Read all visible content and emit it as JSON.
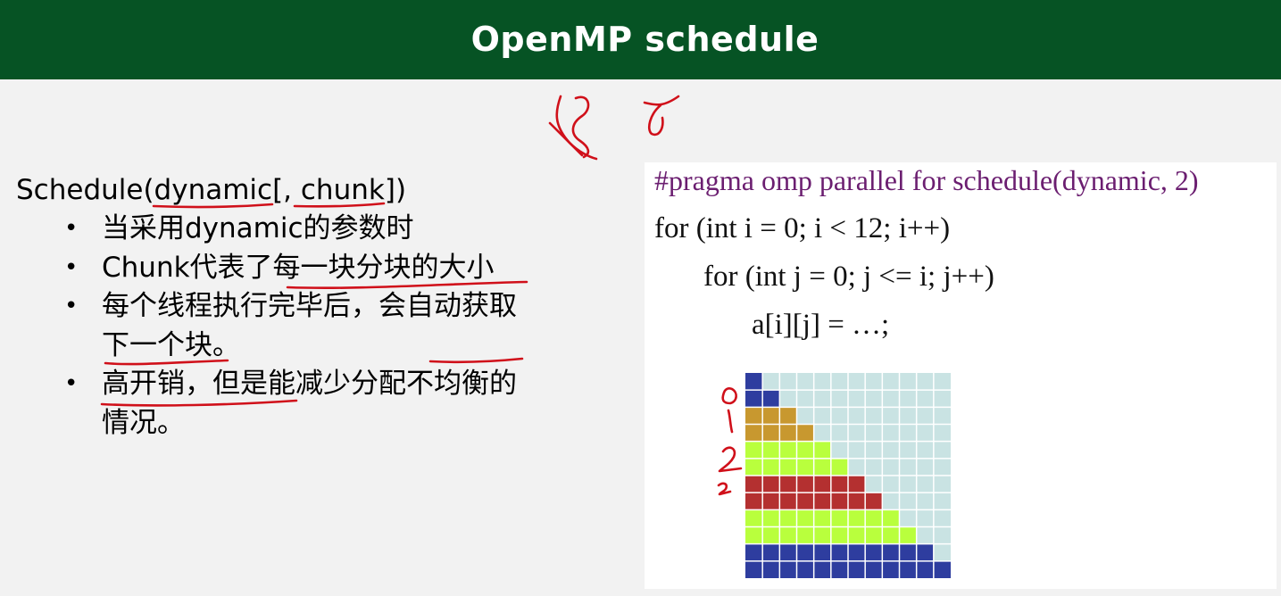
{
  "header": {
    "title": "OpenMP schedule"
  },
  "left": {
    "heading": {
      "prefix": "Schedule(",
      "arg1": "dynamic",
      "mid": "[, ",
      "arg2": "chunk",
      "suffix": "])"
    },
    "bullets": [
      {
        "parts": [
          "当采用dynamic的参数时"
        ]
      },
      {
        "parts": [
          "Chunk代表了",
          "每一块分块的大",
          "小"
        ]
      },
      {
        "parts": [
          "每个线程",
          "执行完毕后，",
          "会自动",
          "获取下一个块",
          "。"
        ]
      },
      {
        "parts": [
          "高开销，但是能减少分配不均衡的情况。"
        ]
      }
    ]
  },
  "code": {
    "lines": [
      "#pragma omp parallel for schedule(dynamic, 2)",
      "for (int i = 0; i < 12; i++)",
      "for (int j = 0; j <= i; j++)",
      "a[i][j] = …;"
    ]
  },
  "grid": {
    "size": 12,
    "rows": [
      {
        "row": 0,
        "filled": 1,
        "color": "#2e3d9f"
      },
      {
        "row": 1,
        "filled": 2,
        "color": "#2e3d9f"
      },
      {
        "row": 2,
        "filled": 3,
        "color": "#c8982f"
      },
      {
        "row": 3,
        "filled": 4,
        "color": "#c8982f"
      },
      {
        "row": 4,
        "filled": 5,
        "color": "#b9ff3d"
      },
      {
        "row": 5,
        "filled": 6,
        "color": "#b9ff3d"
      },
      {
        "row": 6,
        "filled": 7,
        "color": "#b43030"
      },
      {
        "row": 7,
        "filled": 8,
        "color": "#b43030"
      },
      {
        "row": 8,
        "filled": 9,
        "color": "#b9ff3d"
      },
      {
        "row": 9,
        "filled": 10,
        "color": "#b9ff3d"
      },
      {
        "row": 10,
        "filled": 11,
        "color": "#2e3d9f"
      },
      {
        "row": 11,
        "filled": 12,
        "color": "#2e3d9f"
      }
    ],
    "empty_color": "#c9e3e3",
    "line_color": "#ffffff"
  },
  "annotations": {
    "ink_color": "#d0101a",
    "margin_labels": [
      "0",
      "1",
      "2",
      "2"
    ]
  },
  "colors": {
    "header_bg": "#065324",
    "slide_bg": "#f2f2f2",
    "pragma": "#6b1e70"
  }
}
